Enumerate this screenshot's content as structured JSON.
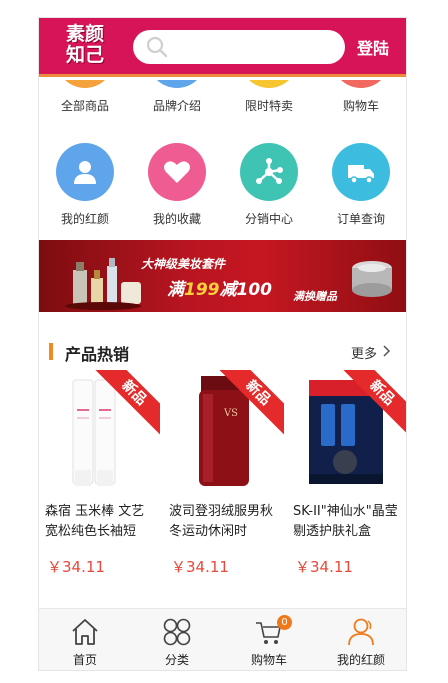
{
  "header": {
    "logo_line1": "素颜",
    "logo_line2": "知己",
    "login_label": "登陆",
    "search_placeholder": ""
  },
  "categories_row1": [
    {
      "label": "全部商品",
      "color": "#f5a23c"
    },
    {
      "label": "品牌介绍",
      "color": "#5fa5ec"
    },
    {
      "label": "限时特卖",
      "color": "#f7c530"
    },
    {
      "label": "购物车",
      "color": "#f0685f"
    }
  ],
  "categories_row2": [
    {
      "label": "我的红颜",
      "color": "#5fa5ec",
      "icon": "user-icon"
    },
    {
      "label": "我的收藏",
      "color": "#ee5c92",
      "icon": "heart-icon"
    },
    {
      "label": "分销中心",
      "color": "#3fc4b4",
      "icon": "share-network-icon"
    },
    {
      "label": "订单查询",
      "color": "#3cbde0",
      "icon": "truck-icon"
    }
  ],
  "banner": {
    "line1": "大神级美妆套件",
    "line2_a": "满",
    "line2_num1": "199",
    "line2_b": "减",
    "line2_num2": "100",
    "line3": "满换赠品"
  },
  "section": {
    "title": "产品热销",
    "more_label": "更多"
  },
  "products": [
    {
      "name": "森宿 玉米棒 文艺宽松纯色长袖短",
      "price": "￥34.11",
      "badge": "新品"
    },
    {
      "name": "波司登羽绒服男秋冬运动休闲时",
      "price": "￥34.11",
      "badge": "新品"
    },
    {
      "name": "SK-II\"神仙水\"晶莹剔透护肤礼盒",
      "price": "￥34.11",
      "badge": "新品"
    }
  ],
  "tabbar": [
    {
      "label": "首页",
      "icon": "home-icon"
    },
    {
      "label": "分类",
      "icon": "grid-icon"
    },
    {
      "label": "购物车",
      "icon": "cart-icon",
      "badge": "0"
    },
    {
      "label": "我的红颜",
      "icon": "person-icon",
      "active": true
    }
  ],
  "colors": {
    "header_bg": "#d81459",
    "accent_orange": "#f08a24",
    "price_red": "#e8473a",
    "ribbon_red": "#e42a2a"
  }
}
